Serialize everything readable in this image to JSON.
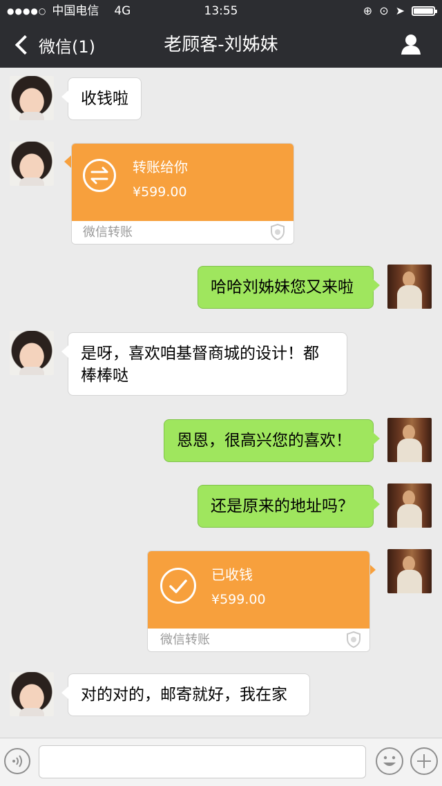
{
  "status_bar": {
    "carrier": "中国电信",
    "network": "4G",
    "time": "13:55",
    "battery_level": 1.0
  },
  "header": {
    "back_label": "微信(1)",
    "title": "老顾客-刘姊妹",
    "profile_icon": "person-icon",
    "background_color": "#2c2d31"
  },
  "messages": [
    {
      "side": "in",
      "type": "text",
      "text": "收钱啦"
    },
    {
      "side": "in",
      "type": "transfer",
      "title": "转账给你",
      "amount": "¥599.00",
      "footer": "微信转账",
      "icon": "transfer-arrows-icon"
    },
    {
      "side": "out",
      "type": "text",
      "text": "哈哈刘姊妹您又来啦"
    },
    {
      "side": "in",
      "type": "text",
      "text_line1": "是呀，喜欢咱基督商城的设计！都",
      "text_line2": "棒棒哒"
    },
    {
      "side": "out",
      "type": "text",
      "text": "恩恩，很高兴您的喜欢！"
    },
    {
      "side": "out",
      "type": "text",
      "text": "还是原来的地址吗？"
    },
    {
      "side": "out",
      "type": "transfer",
      "title": "已收钱",
      "amount": "¥599.00",
      "footer": "微信转账",
      "icon": "checkmark-icon"
    },
    {
      "side": "in",
      "type": "text",
      "text": "对的对的，邮寄就好，我在家"
    }
  ],
  "colors": {
    "outgoing_bubble": "#9fe65e",
    "incoming_bubble": "#ffffff",
    "transfer_card": "#f7a03d",
    "chat_background": "#ebebeb"
  },
  "input_bar": {
    "value": "",
    "voice_icon": "voice-icon",
    "emoji_icon": "emoji-icon",
    "plus_icon": "plus-icon"
  }
}
